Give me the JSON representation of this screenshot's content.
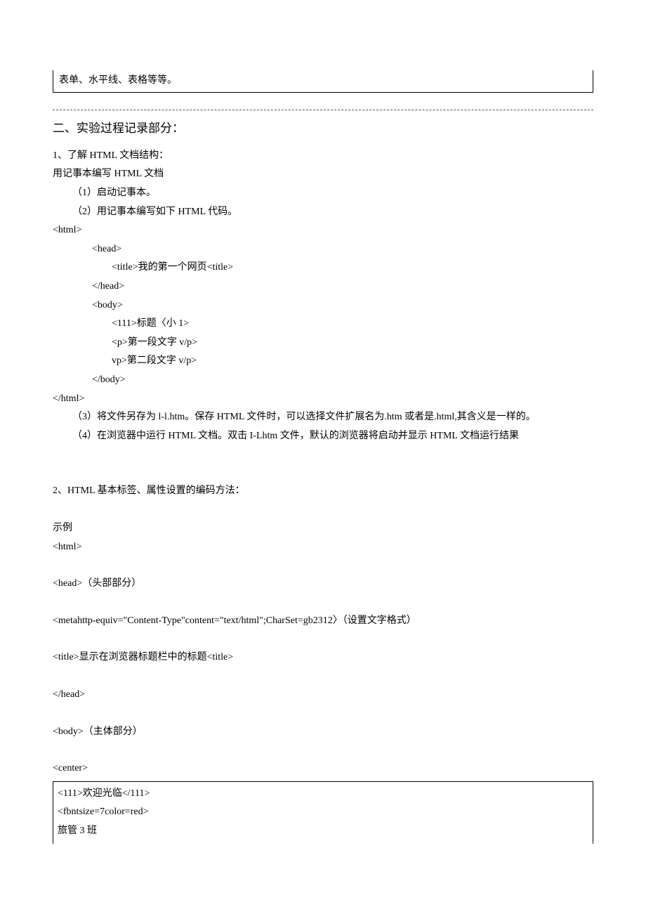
{
  "top_box": "表单、水平线、表格等等。",
  "section2_heading": "二、实验过程记录部分：",
  "s1": {
    "title": "1、了解 HTML 文档结构：",
    "sub": "用记事本编写 HTML 文档",
    "step1": "（1）启动记事本。",
    "step2": "（2）用记事本编写如下 HTML 代码。",
    "code": {
      "l1": "<html>",
      "l2": "<head>",
      "l3": "<title>我的第一个网页<title>",
      "l4": "</head>",
      "l5": "<body>",
      "l6": "<111>标题〈小 1>",
      "l7": "<p>第一段文字 v/p>",
      "l8": "vp>第二段文字 v/p>",
      "l9": "</body>",
      "l10": "</html>"
    },
    "step3": "（3）将文件另存为 l-l.htm。保存 HTML 文件时，可以选择文件扩展名为.htm 或者是.html,其含义是一样的。",
    "step4": "（4）在浏览器中运行 HTML 文档。双击 I-Lhtm 文件，默认的浏览器将启动并显示 HTML 文档运行结果"
  },
  "s2": {
    "title": "2、HTML 基本标签、属性设置的编码方法：",
    "example_label": "示例",
    "l1": "<html>",
    "l2": "<head>（头部部分）",
    "l3": "<metahttp-equiv=\"Content-Type\"content=\"text/html\";CharSet=gb2312〉（设置文字格式）",
    "l4": "<title>显示在浏览器标题栏中的标题<title>",
    "l5": "</head>",
    "l6": "<body>（主体部分）",
    "l7": "<center>",
    "box": {
      "l1": "<111>欢迎光临</111>",
      "l2": "<fbntsize=7color=red>",
      "l3": "旅管 3 班"
    }
  }
}
